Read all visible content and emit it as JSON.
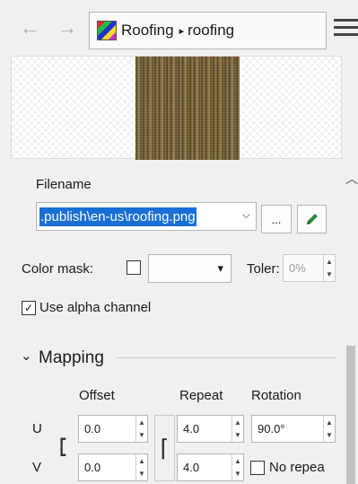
{
  "nav": {
    "back_icon": "back-arrow-icon",
    "forward_icon": "forward-arrow-icon"
  },
  "breadcrumb": {
    "items": [
      "Roofing",
      "roofing"
    ],
    "separator": "▸"
  },
  "menu_icon": "hamburger-menu-icon",
  "file": {
    "label": "Filename",
    "value": ".publish\\en-us\\roofing.png",
    "browse_label": "...",
    "edit_icon": "pencil-icon"
  },
  "color_mask": {
    "label": "Color mask:",
    "dropdown_arrow": "▾"
  },
  "tolerance": {
    "label": "Toler:",
    "value": "0%"
  },
  "alpha": {
    "label": "Use alpha channel",
    "checked": true
  },
  "mapping": {
    "title": "Mapping",
    "chevron": "⌄",
    "columns": [
      "Offset",
      "Repeat",
      "Rotation"
    ],
    "rows": [
      {
        "label": "U",
        "offset": "0.0",
        "repeat": "4.0",
        "rotation": "90.0°"
      },
      {
        "label": "V",
        "offset": "0.0",
        "repeat": "4.0"
      }
    ],
    "no_repeat_label": "No repea"
  },
  "colors": {
    "selection": "#1a6fd6",
    "pencil": "#2e8b3a"
  }
}
